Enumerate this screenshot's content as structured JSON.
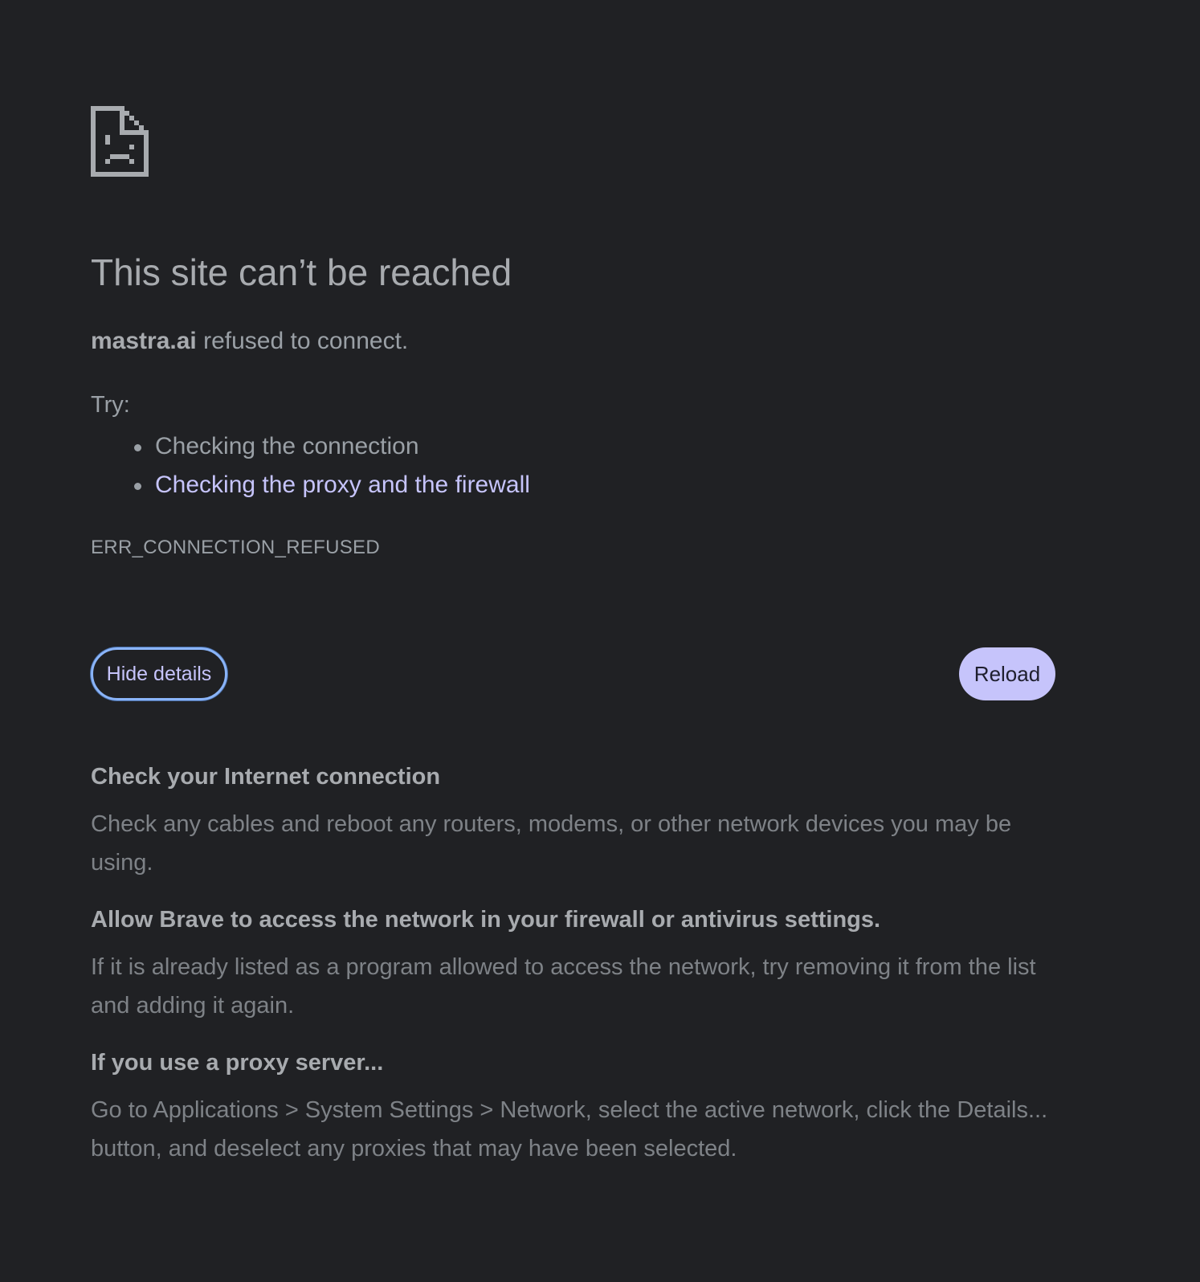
{
  "error_page": {
    "icon": "sad-document-icon",
    "title": "This site can’t be reached",
    "host": "mastra.ai",
    "summary_suffix": " refused to connect.",
    "try_label": "Try:",
    "suggestions": [
      {
        "text": "Checking the connection",
        "is_link": false
      },
      {
        "text": "Checking the proxy and the firewall",
        "is_link": true
      }
    ],
    "error_code": "ERR_CONNECTION_REFUSED"
  },
  "buttons": {
    "details_label": "Hide details",
    "reload_label": "Reload"
  },
  "details": [
    {
      "heading": "Check your Internet connection",
      "body": "Check any cables and reboot any routers, modems, or other network devices you may be using."
    },
    {
      "heading": "Allow Brave to access the network in your firewall or antivirus settings.",
      "body": "If it is already listed as a program allowed to access the network, try removing it from the list and adding it again."
    },
    {
      "heading": "If you use a proxy server...",
      "body": "Go to Applications > System Settings > Network, select the active network, click the Details... button, and deselect any proxies that may have been selected."
    }
  ],
  "colors": {
    "background": "#202124",
    "text": "#9aa0a6",
    "link": "#c6c4fb",
    "focus_ring": "#8ab4f8",
    "primary_button": "#c6c4fb"
  }
}
